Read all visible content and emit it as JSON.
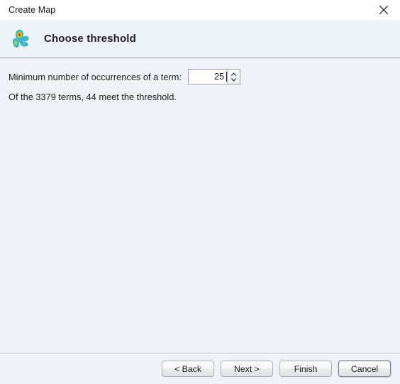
{
  "window": {
    "title": "Create Map",
    "close_icon": "close-icon"
  },
  "header": {
    "icon": "density-map-icon",
    "title": "Choose threshold"
  },
  "form": {
    "threshold_label": "Minimum number of occurrences of a term:",
    "threshold_value": "25",
    "threshold_placeholder": "",
    "spinner_up_icon": "chevron-up-icon",
    "spinner_down_icon": "chevron-down-icon",
    "info_text": "Of the 3379 terms, 44 meet the threshold."
  },
  "footer": {
    "back_label": "< Back",
    "next_label": "Next >",
    "finish_label": "Finish",
    "cancel_label": "Cancel"
  },
  "colors": {
    "titlebar_bg": "#ffffff",
    "header_bg": "#eef3f9",
    "body_bg": "#eff3f8",
    "separator": "#9da3a9",
    "text": "#1b1d21"
  }
}
